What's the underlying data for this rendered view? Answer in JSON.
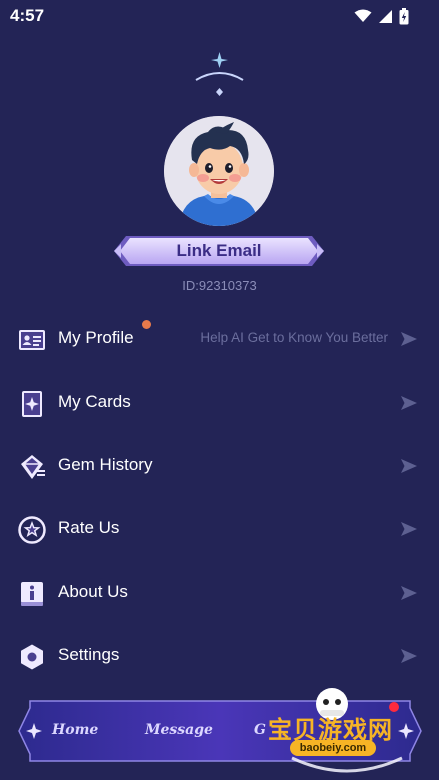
{
  "status_bar": {
    "time": "4:57"
  },
  "profile": {
    "link_email_label": "Link Email",
    "user_id": "ID:92310373"
  },
  "menu": [
    {
      "label": "My Profile",
      "hint": "Help AI Get to Know You Better",
      "icon": "id-card-icon",
      "has_badge": true
    },
    {
      "label": "My Cards",
      "hint": "",
      "icon": "tarot-card-icon"
    },
    {
      "label": "Gem History",
      "hint": "",
      "icon": "gem-icon"
    },
    {
      "label": "Rate Us",
      "hint": "",
      "icon": "star-circle-icon"
    },
    {
      "label": "About Us",
      "hint": "",
      "icon": "info-book-icon"
    },
    {
      "label": "Settings",
      "hint": "",
      "icon": "hexagon-settings-icon"
    }
  ],
  "bottom_nav": {
    "home_label": "Home",
    "message_label": "Message",
    "third_label_partial": "G"
  },
  "watermark": {
    "chinese_text": "宝贝游戏网",
    "url": "baobeiy.com"
  },
  "colors": {
    "background": "#232456",
    "accent_purple": "#3b2d86",
    "badge_orange": "#e77a4b",
    "hint_text": "#6b6e9d"
  }
}
